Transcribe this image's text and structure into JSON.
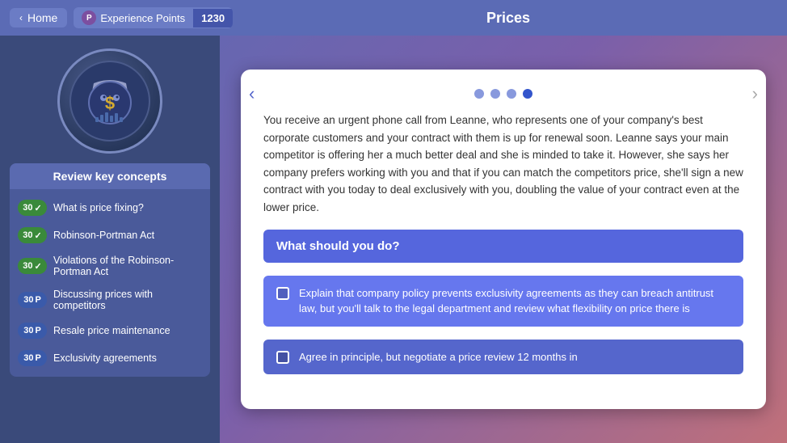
{
  "topbar": {
    "home_label": "Home",
    "xp_label": "Experience Points",
    "xp_value": "1230",
    "title": "Prices"
  },
  "sidebar": {
    "review_title": "Review key concepts",
    "items": [
      {
        "id": "price-fixing",
        "badge_num": "30",
        "badge_type": "check",
        "label": "What is price fixing?"
      },
      {
        "id": "robinson-portman",
        "badge_num": "30",
        "badge_type": "check",
        "label": "Robinson-Portman Act"
      },
      {
        "id": "violations",
        "badge_num": "30",
        "badge_type": "check",
        "label": "Violations of the Robinson-Portman Act"
      },
      {
        "id": "discussing-prices",
        "badge_num": "30",
        "badge_type": "p",
        "label": "Discussing prices with competitors"
      },
      {
        "id": "resale-price",
        "badge_num": "30",
        "badge_type": "p",
        "label": "Resale price maintenance"
      },
      {
        "id": "exclusivity",
        "badge_num": "30",
        "badge_type": "p",
        "label": "Exclusivity agreements"
      }
    ]
  },
  "content": {
    "dots": [
      {
        "active": false
      },
      {
        "active": false
      },
      {
        "active": false
      },
      {
        "active": true
      }
    ],
    "scenario_text": "You receive an urgent phone call from Leanne, who represents one of your company's best corporate customers and your contract with them is up for renewal soon. Leanne says your main competitor is offering her a much better deal and she is minded to take it. However, she says her company prefers working with you and that if you can match the competitors price, she'll sign a new contract with you today to deal exclusively with you, doubling the value of your contract even at the lower price.",
    "question": "What should you do?",
    "answers": [
      {
        "text": "Explain that company policy prevents exclusivity agreements as they can breach antitrust law, but you'll talk to the legal department and review what flexibility on price there is"
      },
      {
        "text": "Agree in principle, but negotiate a price review 12 months in"
      }
    ]
  },
  "nav": {
    "prev_label": "‹",
    "next_label": "›"
  }
}
